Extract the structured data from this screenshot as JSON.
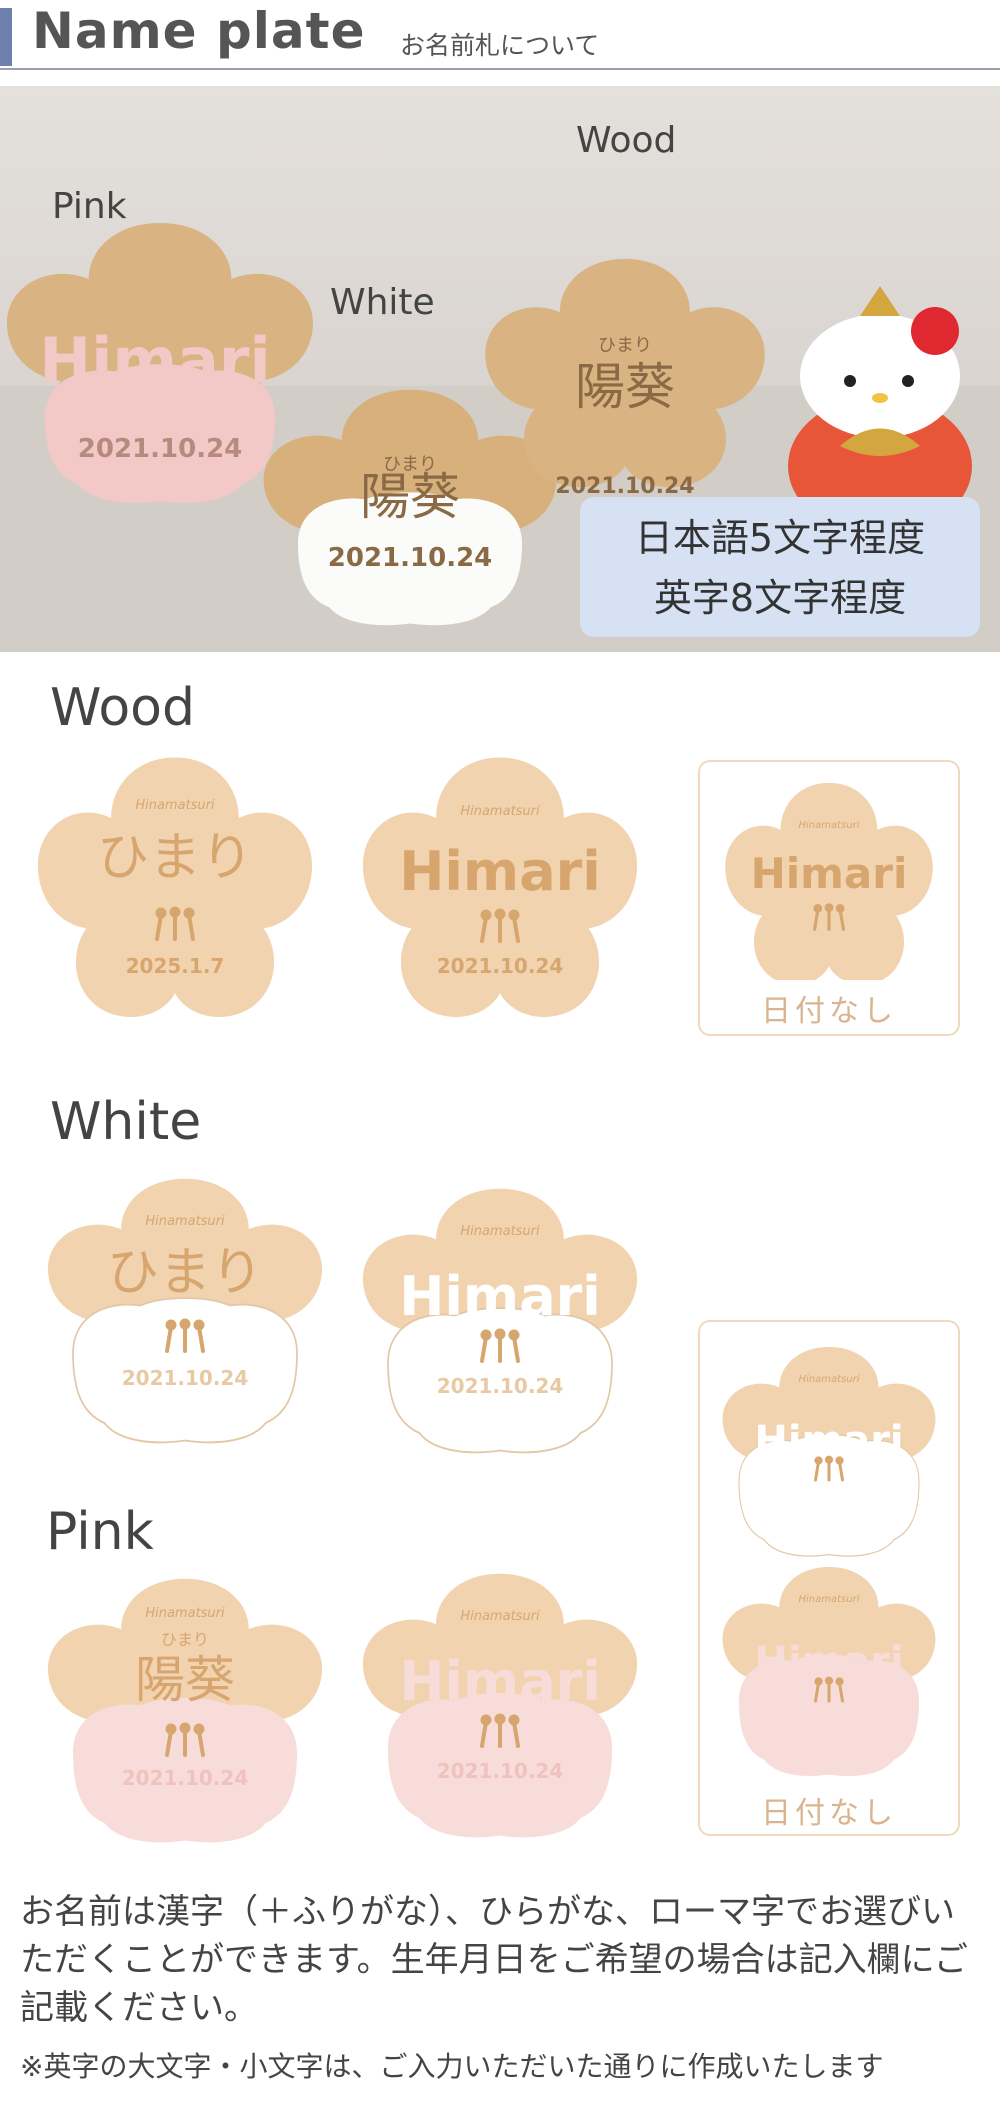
{
  "header": {
    "title": "Name plate",
    "subtitle": "お名前札について"
  },
  "photo": {
    "labels": {
      "pink": "Pink",
      "white": "White",
      "wood": "Wood"
    },
    "plate_script": "Hinamatsuri",
    "plate_furigana": "ひまり",
    "plate_kanji": "陽葵",
    "plate_roman": "Himari",
    "plate_date": "2021.10.24",
    "info_line1": "日本語5文字程度",
    "info_line2": "英字8文字程度"
  },
  "sections": {
    "wood": {
      "label": "Wood",
      "plates": [
        {
          "name": "ひまり",
          "date": "2025.1.7"
        },
        {
          "name": "Himari",
          "date": "2021.10.24"
        },
        {
          "name": "Himari",
          "note": "日付なし"
        }
      ]
    },
    "white": {
      "label": "White",
      "plates": [
        {
          "name": "ひまり",
          "date": "2021.10.24"
        },
        {
          "name": "Himari",
          "date": "2021.10.24"
        }
      ]
    },
    "pink": {
      "label": "Pink",
      "plates": [
        {
          "furigana": "ひまり",
          "name": "陽葵",
          "date": "2021.10.24"
        },
        {
          "name": "Himari",
          "date": "2021.10.24"
        }
      ]
    },
    "nodate_column": {
      "name_white": "Himari",
      "name_pink": "Himari",
      "note": "日付なし"
    }
  },
  "plate_script": "Hinamatsuri",
  "colors": {
    "wood": "#f2d3b0",
    "engrave": "#d7a66f",
    "pink": "#f7dcd9",
    "white": "#ffffff",
    "outline": "#e2c8a7",
    "accent_bar": "#6f7fae",
    "info_box": "#d6e2f4"
  },
  "description": "お名前は漢字（＋ふりがな）、ひらがな、ローマ字でお選びいただくことができます。生年月日をご希望の場合は記入欄にご記載ください。",
  "note": "※英字の大文字・小文字は、ご入力いただいた通りに作成いたします"
}
